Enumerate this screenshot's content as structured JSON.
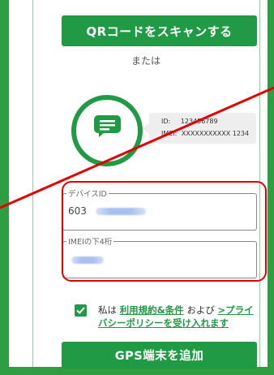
{
  "scan_button": {
    "label": "QRコードをスキャンする"
  },
  "or_text": "または",
  "label_card": {
    "id_prefix": "ID:",
    "id_value": "123456789",
    "imei_prefix": "IMEI:",
    "imei_value": "XXXXXXXXXXX 1234"
  },
  "device_id_field": {
    "label": "デバイスID",
    "value_prefix": "603"
  },
  "imei_field": {
    "label": "IMEIの下4桁",
    "value": ""
  },
  "consent": {
    "checked": true,
    "text_before": "私は ",
    "terms_link": "利用規約&条件",
    "text_middle": " および ",
    "privacy_link": ">プライバシーポリシーを受け入れます"
  },
  "add_button": {
    "label": "GPS端末を追加"
  },
  "colors": {
    "brand_green": "#219a45",
    "annotation_red": "#e00000"
  }
}
